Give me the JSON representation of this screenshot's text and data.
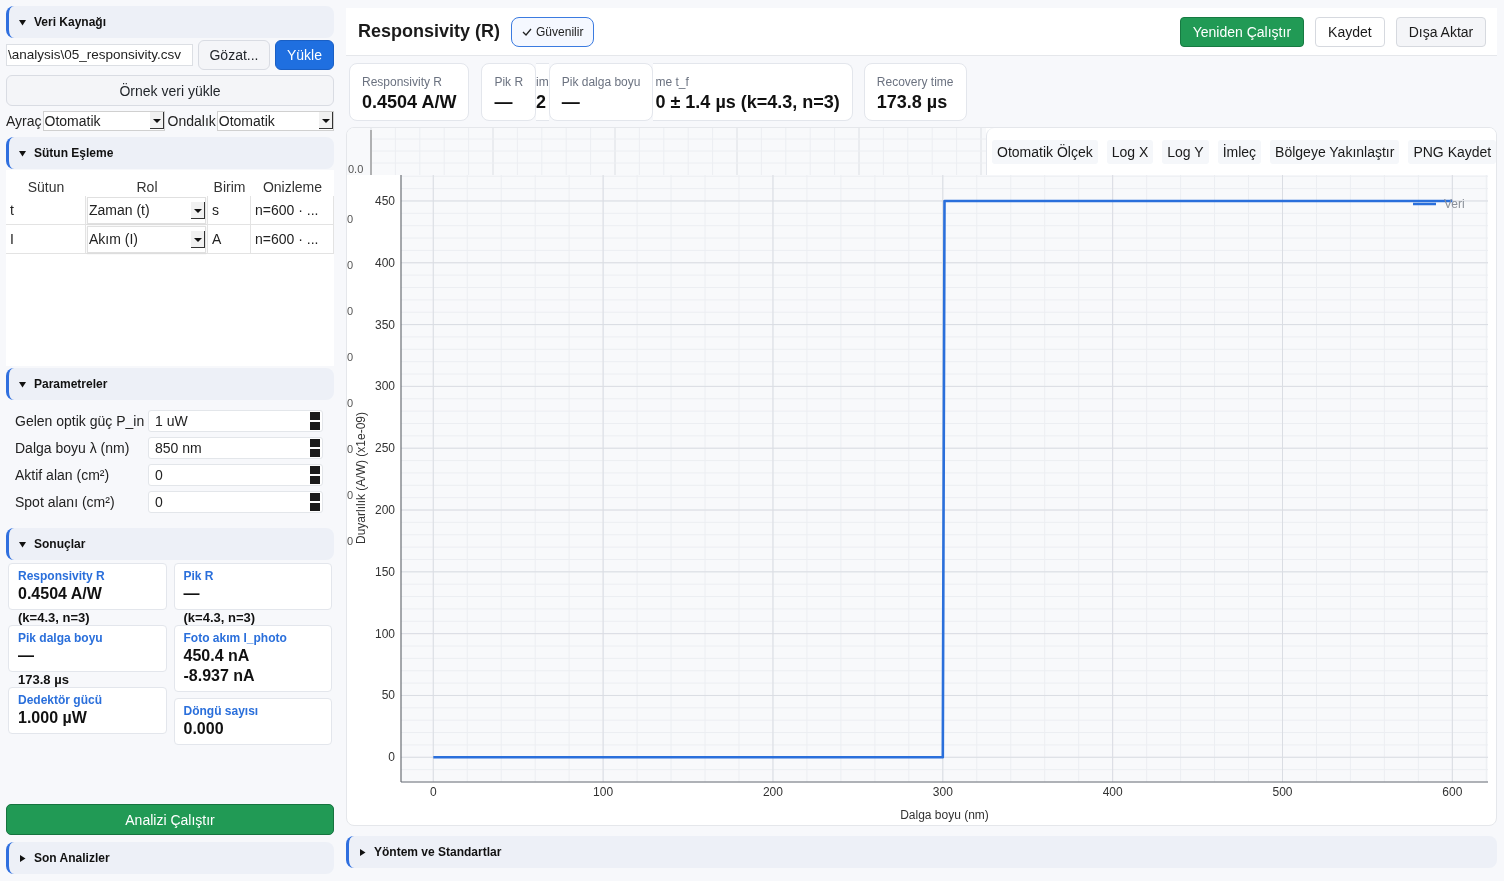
{
  "header": {
    "title": "Responsivity (R)",
    "badge": "Güvenilir",
    "buttons": [
      {
        "label": "Yeniden Çalıştır",
        "kind": "primary"
      },
      {
        "label": "Kaydet",
        "kind": "outline"
      },
      {
        "label": "Dışa Aktar",
        "kind": "secondary"
      }
    ]
  },
  "sidebar": {
    "data_source": {
      "title": "Veri Kaynağı",
      "expanded": true,
      "file_path": "\\analysis\\05_responsivity.csv",
      "browse_button": "Gözat...",
      "load_button": "Yükle",
      "sample_button": "Örnek veri yükle",
      "separator_label": "Ayraç",
      "separator_value": "Otomatik",
      "decimal_label": "Ondalık",
      "decimal_value": "Otomatik"
    },
    "column_mapping": {
      "title": "Sütun Eşleme",
      "expanded": true,
      "columns": [
        "Sütun",
        "Rol",
        "Birim",
        "Onizleme"
      ],
      "rows": [
        {
          "column": "t",
          "role": "Zaman (t)",
          "unit": "s",
          "preview": "n=600 · ..."
        },
        {
          "column": "I",
          "role": "Akım (I)",
          "unit": "A",
          "preview": "n=600 · ..."
        }
      ]
    },
    "parameters": {
      "title": "Parametreler",
      "expanded": true,
      "fields": [
        {
          "label": "Gelen optik güç P_in",
          "value": "1 uW"
        },
        {
          "label": "Dalga boyu λ (nm)",
          "value": "850 nm"
        },
        {
          "label": "Aktif alan (cm²)",
          "value": "0"
        },
        {
          "label": "Spot alanı (cm²)",
          "value": "0"
        }
      ]
    },
    "results": {
      "title": "Sonuçlar",
      "expanded": true,
      "columns": [
        [
          {
            "kind": "card",
            "title": "Responsivity R",
            "value": "0.4504 A/W"
          },
          {
            "kind": "peek",
            "value": "(k=4.3, n=3)"
          },
          {
            "kind": "card",
            "title": "Pik dalga boyu",
            "value": "—"
          },
          {
            "kind": "peek",
            "value": "173.8 µs"
          },
          {
            "kind": "card",
            "title": "Dedektör gücü",
            "value": "1.000 µW"
          }
        ],
        [
          {
            "kind": "card",
            "title": "Pik R",
            "value": "—"
          },
          {
            "kind": "peek",
            "value": "(k=4.3, n=3)"
          },
          {
            "kind": "card",
            "title": "Foto akım I_photo",
            "value": "450.4 nA",
            "detail": "-8.937 nA"
          },
          {
            "kind": "card",
            "title": "Döngü sayısı",
            "value": "0.000"
          }
        ]
      ]
    },
    "run_button": "Analizi Çalıştır",
    "recent": {
      "title": "Son Analizler",
      "expanded": false
    }
  },
  "metrics": [
    {
      "kind": "card",
      "title": "Responsivity R",
      "value": "0.4504 A/W"
    },
    {
      "kind": "card",
      "title": "Pik R",
      "value": "—"
    },
    {
      "kind": "sliver",
      "title": "im",
      "value": "2"
    },
    {
      "kind": "card",
      "title": "Pik dalga boyu",
      "value": "—"
    },
    {
      "kind": "clipped",
      "title": "me t_f",
      "value": "0 ± 1.4 µs (k=4.3, n=3)"
    },
    {
      "kind": "card",
      "title": "Recovery time",
      "value": "173.8 µs"
    }
  ],
  "chart_panel": {
    "background_chart": {
      "top_label": "0.0",
      "y_labels": [
        "0",
        "0",
        "0",
        "0",
        "0",
        "0",
        "0",
        "0"
      ]
    },
    "toolbar": [
      "Otomatik Ölçek",
      "Log X",
      "Log Y",
      "İmleç",
      "Bölgeye Yakınlaştır",
      "PNG Kaydet"
    ],
    "chart_data": {
      "type": "line",
      "xlabel": "Dalga boyu (nm)",
      "ylabel": "Duyarlılık (A/W) (x1e-09)",
      "x": [
        0,
        100,
        200,
        300,
        301,
        400,
        500,
        600
      ],
      "series": [
        {
          "name": "Veri",
          "color": "#2a6fdb",
          "values": [
            0,
            0,
            0,
            0,
            450,
            450,
            450,
            450
          ]
        }
      ],
      "xlim": [
        -19,
        621
      ],
      "ylim": [
        -20,
        471
      ],
      "xticks": [
        0,
        100,
        200,
        300,
        400,
        500,
        600
      ],
      "yticks": [
        0,
        50,
        100,
        150,
        200,
        250,
        300,
        350,
        400,
        450
      ],
      "grid": true
    }
  },
  "methods": {
    "title": "Yöntem ve Standartlar",
    "expanded": false
  }
}
